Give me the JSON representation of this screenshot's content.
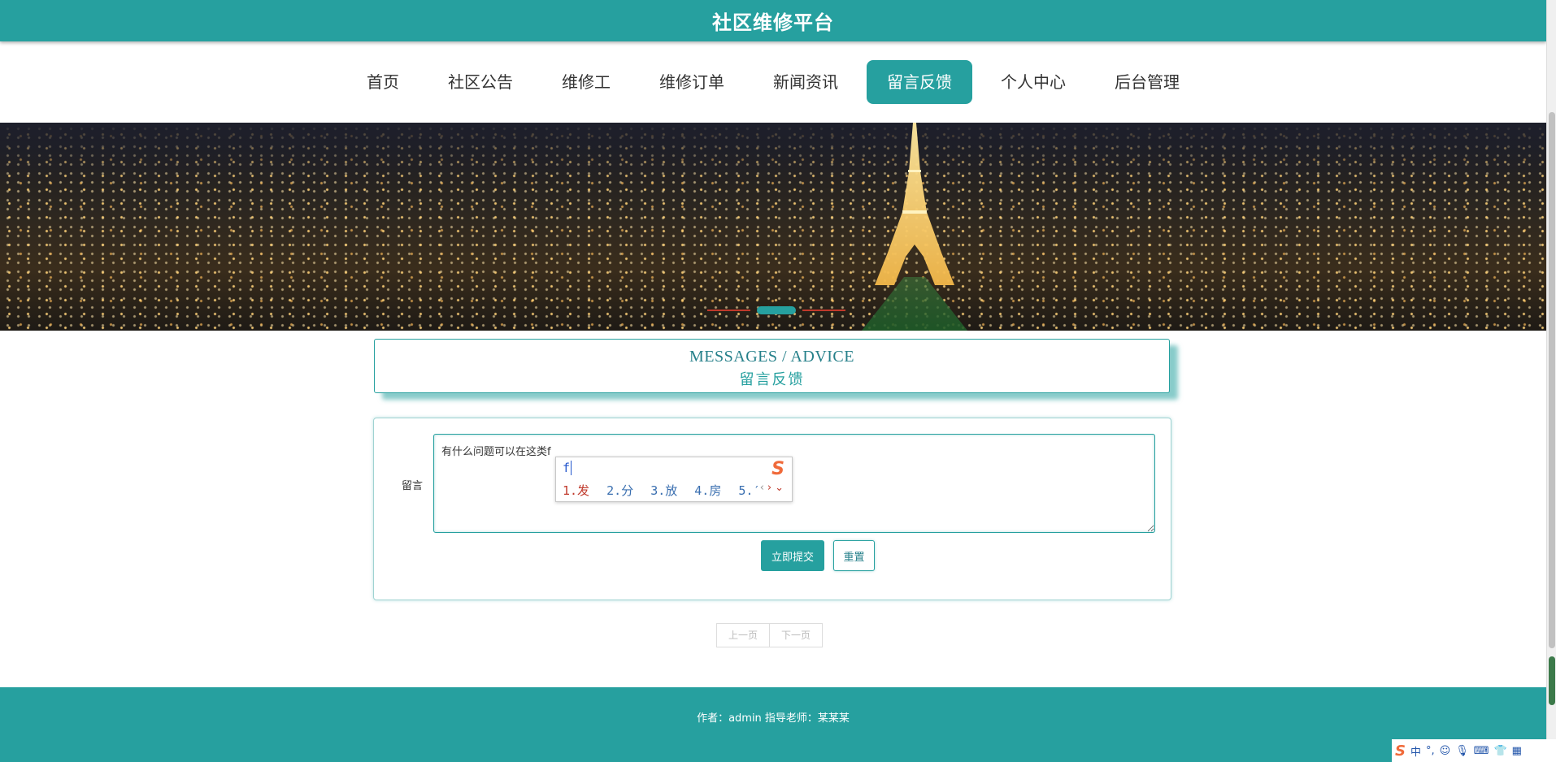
{
  "header": {
    "title": "社区维修平台"
  },
  "nav": {
    "items": [
      {
        "label": "首页"
      },
      {
        "label": "社区公告"
      },
      {
        "label": "维修工"
      },
      {
        "label": "维修订单"
      },
      {
        "label": "新闻资讯"
      },
      {
        "label": "留言反馈",
        "active": true
      },
      {
        "label": "个人中心"
      },
      {
        "label": "后台管理"
      }
    ]
  },
  "section": {
    "title_en": "MESSAGES / ADVICE",
    "title_cn": "留言反馈"
  },
  "form": {
    "label": "留言",
    "message_value": "有什么问题可以在这类f",
    "submit_label": "立即提交",
    "reset_label": "重置"
  },
  "ime": {
    "typed": "f",
    "candidates": [
      "1.发",
      "2.分",
      "3.放",
      "4.房",
      "5.′"
    ]
  },
  "pager": {
    "prev_label": "上一页",
    "next_label": "下一页"
  },
  "footer": {
    "credit": "作者：admin 指导老师：某某某"
  },
  "tray": {
    "lang": "中"
  },
  "colors": {
    "accent": "#26a09f"
  }
}
